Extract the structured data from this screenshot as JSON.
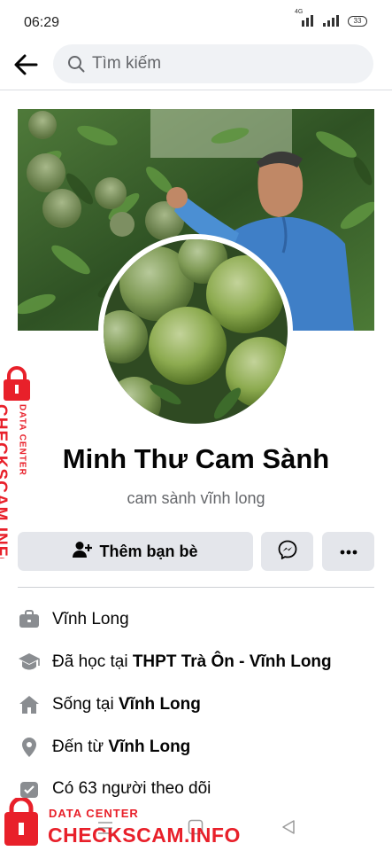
{
  "status_bar": {
    "time": "06:29",
    "network": "4G",
    "battery": "33"
  },
  "search": {
    "placeholder": "Tìm kiếm"
  },
  "profile": {
    "name": "Minh Thư Cam Sành",
    "bio": "cam sành vĩnh long"
  },
  "actions": {
    "add_friend_label": "Thêm bạn bè"
  },
  "info": {
    "work": "Vĩnh Long",
    "education_prefix": "Đã học tại ",
    "education_value": "THPT Trà Ôn - Vĩnh Long",
    "lives_prefix": "Sống tại ",
    "lives_value": "Vĩnh Long",
    "from_prefix": "Đến từ ",
    "from_value": "Vĩnh Long",
    "followers": "Có 63 người theo dõi"
  },
  "watermark": {
    "brand": "CHECKSCAM.INFO",
    "tagline": "DATA CENTER"
  },
  "icons": {
    "back": "back-arrow-icon",
    "search": "search-icon",
    "add_friend": "add-person-icon",
    "messenger": "messenger-icon",
    "more": "more-dots-icon",
    "work": "briefcase-icon",
    "education": "graduation-cap-icon",
    "home": "home-icon",
    "location": "location-pin-icon",
    "followers": "followers-icon"
  },
  "colors": {
    "accent_red": "#e8202a",
    "secondary_text": "#65676b",
    "button_bg": "#e4e6eb"
  }
}
